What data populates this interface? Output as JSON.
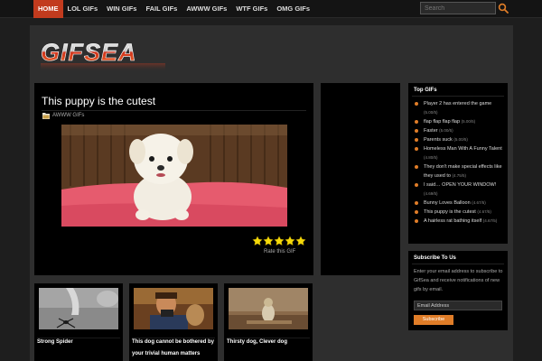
{
  "nav": {
    "items": [
      {
        "label": "HOME",
        "active": true
      },
      {
        "label": "LOL GIFs"
      },
      {
        "label": "WIN GIFs"
      },
      {
        "label": "FAIL GIFs"
      },
      {
        "label": "AWWW GIFs"
      },
      {
        "label": "WTF GIFs"
      },
      {
        "label": "OMG GIFs"
      }
    ],
    "search_placeholder": "Search",
    "search_icon": "search-icon"
  },
  "logo": {
    "text": "GIFSEA"
  },
  "post": {
    "title": "This puppy is the cutest",
    "category": "AWWW GIFs",
    "rating_stars": 5,
    "rate_label": "Rate this GIF"
  },
  "top_gifs": {
    "title": "Top GIFs",
    "items": [
      {
        "label": "Player 2 has entered the game",
        "score": "(5.00/5)"
      },
      {
        "label": "flap flap flap flap",
        "score": "(5.00/5)"
      },
      {
        "label": "Faster",
        "score": "(5.00/5)"
      },
      {
        "label": "Parents suck",
        "score": "(5.00/5)"
      },
      {
        "label": "Homeless Man With A Funny Talent",
        "score": "(4.80/5)"
      },
      {
        "label": "They don't make special effects like they used to",
        "score": "(4.75/5)"
      },
      {
        "label": "I said… OPEN YOUR WINDOW!",
        "score": "(4.69/5)"
      },
      {
        "label": "Bunny Loves Balloon",
        "score": "(4.67/5)"
      },
      {
        "label": "This puppy is the cutest",
        "score": "(4.67/5)"
      },
      {
        "label": "A hairless rat bathing itself",
        "score": "(4.67/5)"
      }
    ]
  },
  "subscribe": {
    "title": "Subscribe To Us",
    "text": "Enter your email address to subscribe to GifSea and receive notifications of new gifs by email.",
    "email_placeholder": "Email Address",
    "button_label": "Subscribe"
  },
  "thumbs": [
    {
      "caption": "Strong Spider"
    },
    {
      "caption": "This dog cannot be bothered by your trivial human matters"
    },
    {
      "caption": "Thirsty dog, Clever dog"
    }
  ],
  "colors": {
    "accent": "#e07d28",
    "nav_active": "#c23b1e",
    "star": "#f5d90a"
  }
}
